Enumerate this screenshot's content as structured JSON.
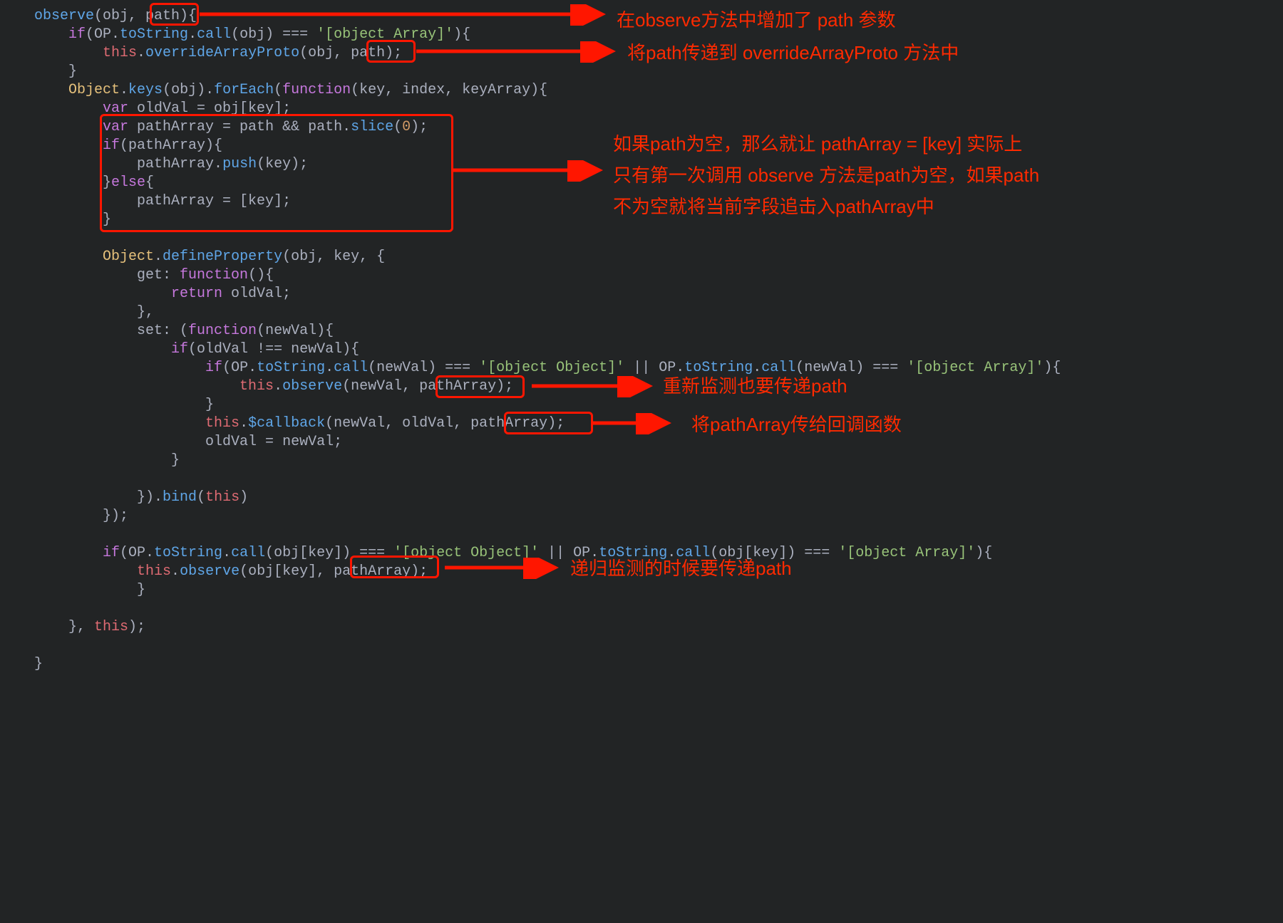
{
  "code": {
    "l1a": "observe",
    "l1b": "(obj, ",
    "l1c": "path",
    "l1d": "){",
    "l2a": "if",
    "l2b": "(OP.",
    "l2c": "toString",
    "l2d": ".",
    "l2e": "call",
    "l2f": "(obj) === ",
    "l2g": "'[object Array]'",
    "l2h": "){",
    "l3a": "this",
    "l3b": ".",
    "l3c": "overrideArrayProto",
    "l3d": "(obj, ",
    "l3e": "path",
    "l3f": ");",
    "l4": "}",
    "l5a": "Object",
    "l5b": ".",
    "l5c": "keys",
    "l5d": "(obj).",
    "l5e": "forEach",
    "l5f": "(",
    "l5g": "function",
    "l5h": "(key, index, keyArray){",
    "l6a": "var",
    "l6b": " oldVal = obj[key];",
    "l7a": "var",
    "l7b": " pathArray = path && path.",
    "l7c": "slice",
    "l7d": "(",
    "l7e": "0",
    "l7f": ");",
    "l8a": "if",
    "l8b": "(pathArray){",
    "l9a": "pathArray.",
    "l9b": "push",
    "l9c": "(key);",
    "l10a": "}",
    "l10b": "else",
    "l10c": "{",
    "l11": "pathArray = [key];",
    "l12": "}",
    "l14a": "Object",
    "l14b": ".",
    "l14c": "defineProperty",
    "l14d": "(obj, key, {",
    "l15a": "get: ",
    "l15b": "function",
    "l15c": "(){",
    "l16a": "return",
    "l16b": " oldVal;",
    "l17": "},",
    "l18a": "set: (",
    "l18b": "function",
    "l18c": "(newVal){",
    "l19a": "if",
    "l19b": "(oldVal !== newVal){",
    "l20a": "if",
    "l20b": "(OP.",
    "l20c": "toString",
    "l20d": ".",
    "l20e": "call",
    "l20f": "(newVal) === ",
    "l20g": "'[object Object]'",
    "l20h": " || OP.",
    "l20i": "toString",
    "l20j": ".",
    "l20k": "call",
    "l20l": "(newVal) === ",
    "l20m": "'[object Array]'",
    "l20n": "){",
    "l21a": "this",
    "l21b": ".",
    "l21c": "observe",
    "l21d": "(newVal, ",
    "l21e": "pathArray",
    "l21f": ");",
    "l22": "}",
    "l23a": "this",
    "l23b": ".",
    "l23c": "$callback",
    "l23d": "(newVal, oldVal, ",
    "l23e": "pathArray",
    "l23f": ");",
    "l24": "oldVal = newVal;",
    "l25": "}",
    "l27a": "}).",
    "l27b": "bind",
    "l27c": "(",
    "l27d": "this",
    "l27e": ")",
    "l28": "});",
    "l30a": "if",
    "l30b": "(OP.",
    "l30c": "toString",
    "l30d": ".",
    "l30e": "call",
    "l30f": "(obj[key]) === ",
    "l30g": "'[object Object]'",
    "l30h": " || OP.",
    "l30i": "toString",
    "l30j": ".",
    "l30k": "call",
    "l30l": "(obj[key]) === ",
    "l30m": "'[object Array]'",
    "l30n": "){",
    "l31a": "this",
    "l31b": ".",
    "l31c": "observe",
    "l31d": "(obj[key], ",
    "l31e": "pathArray",
    "l31f": ");",
    "l32": "}",
    "l34a": "}, ",
    "l34b": "this",
    "l34c": ");",
    "l36": "}"
  },
  "annotations": {
    "a1": "在observe方法中增加了 path 参数",
    "a2": "将path传递到 overrideArrayProto 方法中",
    "a3": "如果path为空，那么就让 pathArray = [key] 实际上",
    "a3b": "只有第一次调用 observe 方法是path为空，如果path",
    "a3c": "不为空就将当前字段追击入pathArray中",
    "a4": "重新监测也要传递path",
    "a5": "将pathArray传给回调函数",
    "a6": "递归监测的时候要传递path"
  }
}
